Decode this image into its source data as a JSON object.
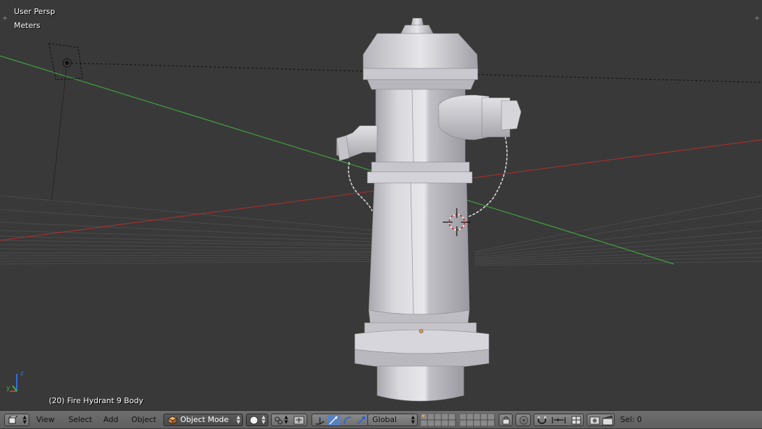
{
  "viewport": {
    "view_name": "User Persp",
    "units": "Meters",
    "object_info": "(20) Fire Hydrant 9 Body"
  },
  "header": {
    "menus": [
      "View",
      "Select",
      "Add",
      "Object"
    ],
    "mode": "Object Mode",
    "orientation": "Global",
    "selection": "Sel: 0"
  },
  "icons": {
    "editor_type": "3d-view-icon",
    "mode": "cube-icon",
    "shading": "solid-sphere-icon",
    "pivot": "pivot-icon",
    "manipulator": "manipulator-icon",
    "translate": "translate-icon",
    "rotate": "rotate-icon",
    "scale": "scale-icon",
    "layers": "layers-icon",
    "lock_camera": "lock-icon",
    "proportional": "proportional-edit-icon",
    "snap": "magnet-icon",
    "snap_target": "snap-target-icon",
    "render": "render-icon",
    "render_anim": "clapper-icon"
  },
  "colors": {
    "background": "#393939",
    "grid_x_axis": "#a03030",
    "grid_y_axis": "#40a040",
    "header": "#6a6a6a",
    "hydrant": "#cfcfd4"
  }
}
